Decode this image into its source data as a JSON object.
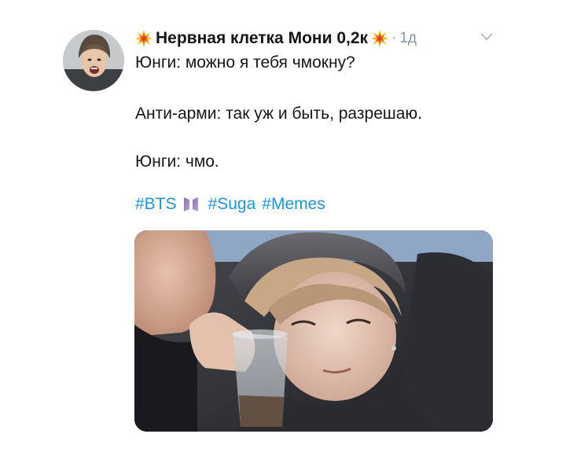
{
  "tweet": {
    "author_name": "Нервная клетка Мони 0,2к",
    "separator": "·",
    "timestamp": "1д",
    "lines": [
      "Юнги: можно я тебя чмокну?",
      "Анти-арми: так уж и быть, разрешаю.",
      "Юнги: чмо."
    ],
    "hashtags": [
      "#BTS",
      "#Suga",
      "#Memes"
    ]
  },
  "icons": {
    "name_decoration": "collision-sparkle-icon",
    "bts_emoji": "bts-logo-icon",
    "menu": "chevron-down-icon"
  },
  "colors": {
    "text": "#14171a",
    "muted": "#8a98a5",
    "link": "#1b95e0"
  }
}
